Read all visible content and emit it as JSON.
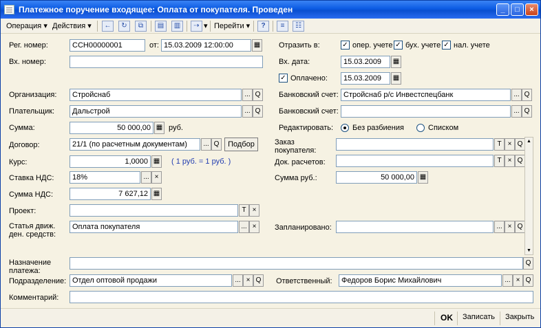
{
  "window": {
    "title": "Платежное поручение входящее: Оплата от покупателя. Проведен",
    "controls": {
      "minimize": "_",
      "maximize": "□",
      "close": "×"
    }
  },
  "toolbar": {
    "operation": "Операция",
    "actions": "Действия",
    "goto": "Перейти",
    "help": "?"
  },
  "form": {
    "reg_number_label": "Рег. номер:",
    "reg_number": "ССН00000001",
    "from_label": "от:",
    "date": "15.03.2009 12:00:00",
    "in_number_label": "Вх. номер:",
    "in_number": "",
    "reflect_label": "Отразить в:",
    "reflect_oper": "опер. учете",
    "reflect_buh": "бух. учете",
    "reflect_nal": "нал. учете",
    "in_date_label": "Вх. дата:",
    "in_date": "15.03.2009",
    "paid_label": "Оплачено:",
    "paid_date": "15.03.2009",
    "org_label": "Организация:",
    "org": "Стройснаб",
    "bank_acc_label": "Банковский счет:",
    "bank_acc": "Стройснаб р/с Инвестспецбанк",
    "payer_label": "Плательщик:",
    "payer": "Дальстрой",
    "bank_acc2_label": "Банковский счет:",
    "bank_acc2": "",
    "sum_label": "Сумма:",
    "sum": "50 000,00",
    "sum_unit": "руб.",
    "edit_label": "Редактировать:",
    "edit_nosplit": "Без разбиения",
    "edit_list": "Списком",
    "contract_label": "Договор:",
    "contract": "21/1 (по расчетным документам)",
    "select_button": "Подбор",
    "rate_label": "Курс:",
    "rate": "1,0000",
    "rate_note": "( 1 руб. = 1 руб. )",
    "vat_rate_label": "Ставка НДС:",
    "vat_rate": "18%",
    "vat_sum_label": "Сумма НДС:",
    "vat_sum": "7 627,12",
    "project_label": "Проект:",
    "project": "",
    "cashflow_label_1": "Статья движ.",
    "cashflow_label_2": "ден. средств:",
    "cashflow": "Оплата покупателя",
    "order_label_1": "Заказ",
    "order_label_2": "покупателя:",
    "order": "",
    "settle_doc_label": "Док. расчетов:",
    "settle_doc": "",
    "sum_rub_label": "Сумма руб.:",
    "sum_rub": "50 000,00",
    "planned_label": "Запланировано:",
    "planned": "",
    "purpose_label_1": "Назначение",
    "purpose_label_2": "платежа:",
    "purpose": "",
    "division_label": "Подразделение:",
    "division": "Отдел оптовой продажи",
    "responsible_label": "Ответственный:",
    "responsible": "Федоров Борис Михайлович",
    "comment_label": "Комментарий:",
    "comment": ""
  },
  "statusbar": {
    "ok": "OK",
    "save": "Записать",
    "close": "Закрыть"
  },
  "glyphs": {
    "select": "...",
    "search": "Q",
    "clear": "×",
    "text": "T",
    "check": "✓",
    "calc": "▦",
    "arrow": "▾"
  }
}
